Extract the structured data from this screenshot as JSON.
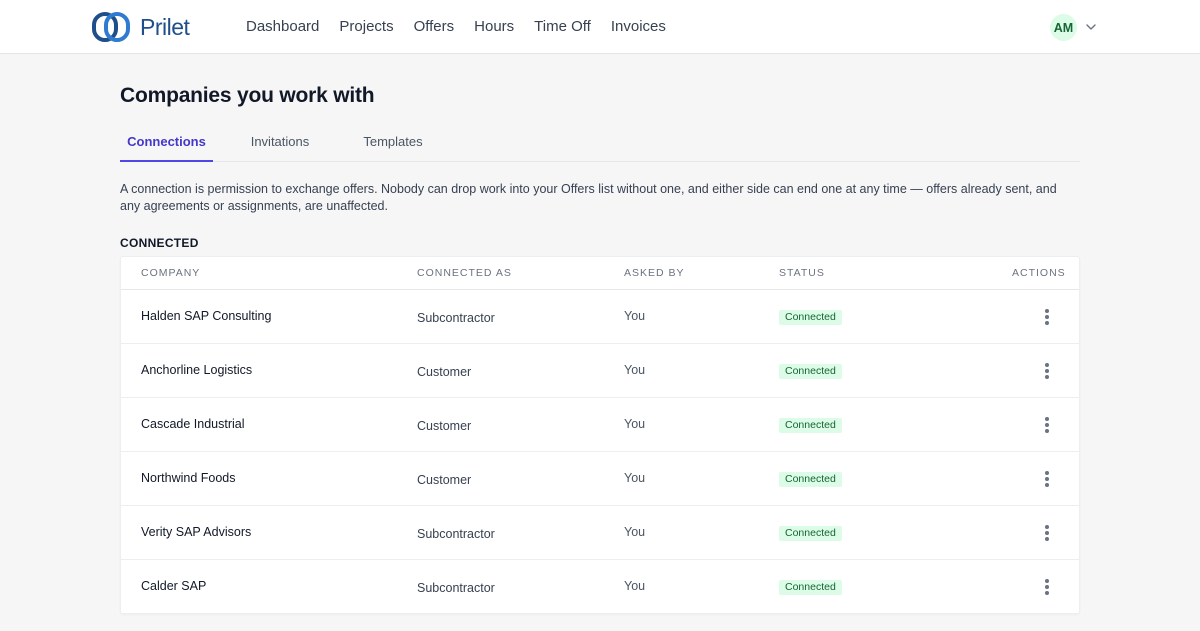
{
  "app": {
    "brand": "Prilet"
  },
  "nav": {
    "items": [
      "Dashboard",
      "Projects",
      "Offers",
      "Hours",
      "Time Off",
      "Invoices"
    ]
  },
  "user": {
    "initials": "AM"
  },
  "page": {
    "title": "Companies you work with",
    "tabs": [
      {
        "label": "Connections",
        "active": true
      },
      {
        "label": "Invitations",
        "active": false
      },
      {
        "label": "Templates",
        "active": false
      }
    ],
    "intro": "A connection is permission to exchange offers. Nobody can drop work into your Offers list without one, and either side can end one at any time — offers already sent, and any agreements or assignments, are unaffected.",
    "section_label": "CONNECTED"
  },
  "table": {
    "headers": {
      "company": "COMPANY",
      "connected_as": "CONNECTED AS",
      "asked_by": "ASKED BY",
      "status": "STATUS",
      "actions": "ACTIONS"
    },
    "rows": [
      {
        "company": "Halden SAP Consulting",
        "connected_as": "Subcontractor",
        "asked_by": "You",
        "status": "Connected"
      },
      {
        "company": "Anchorline Logistics",
        "connected_as": "Customer",
        "asked_by": "You",
        "status": "Connected"
      },
      {
        "company": "Cascade Industrial",
        "connected_as": "Customer",
        "asked_by": "You",
        "status": "Connected"
      },
      {
        "company": "Northwind Foods",
        "connected_as": "Customer",
        "asked_by": "You",
        "status": "Connected"
      },
      {
        "company": "Verity SAP Advisors",
        "connected_as": "Subcontractor",
        "asked_by": "You",
        "status": "Connected"
      },
      {
        "company": "Calder SAP",
        "connected_as": "Subcontractor",
        "asked_by": "You",
        "status": "Connected"
      }
    ]
  },
  "colors": {
    "accent": "#4f46e5",
    "brand": "#1f4f8a",
    "status_connected_bg": "#dcfce7",
    "status_connected_text": "#166534"
  },
  "icons": {
    "logo": "prilet-logo-icon",
    "user_menu": "chevron-down-icon",
    "row_actions": "kebab-menu-icon"
  }
}
